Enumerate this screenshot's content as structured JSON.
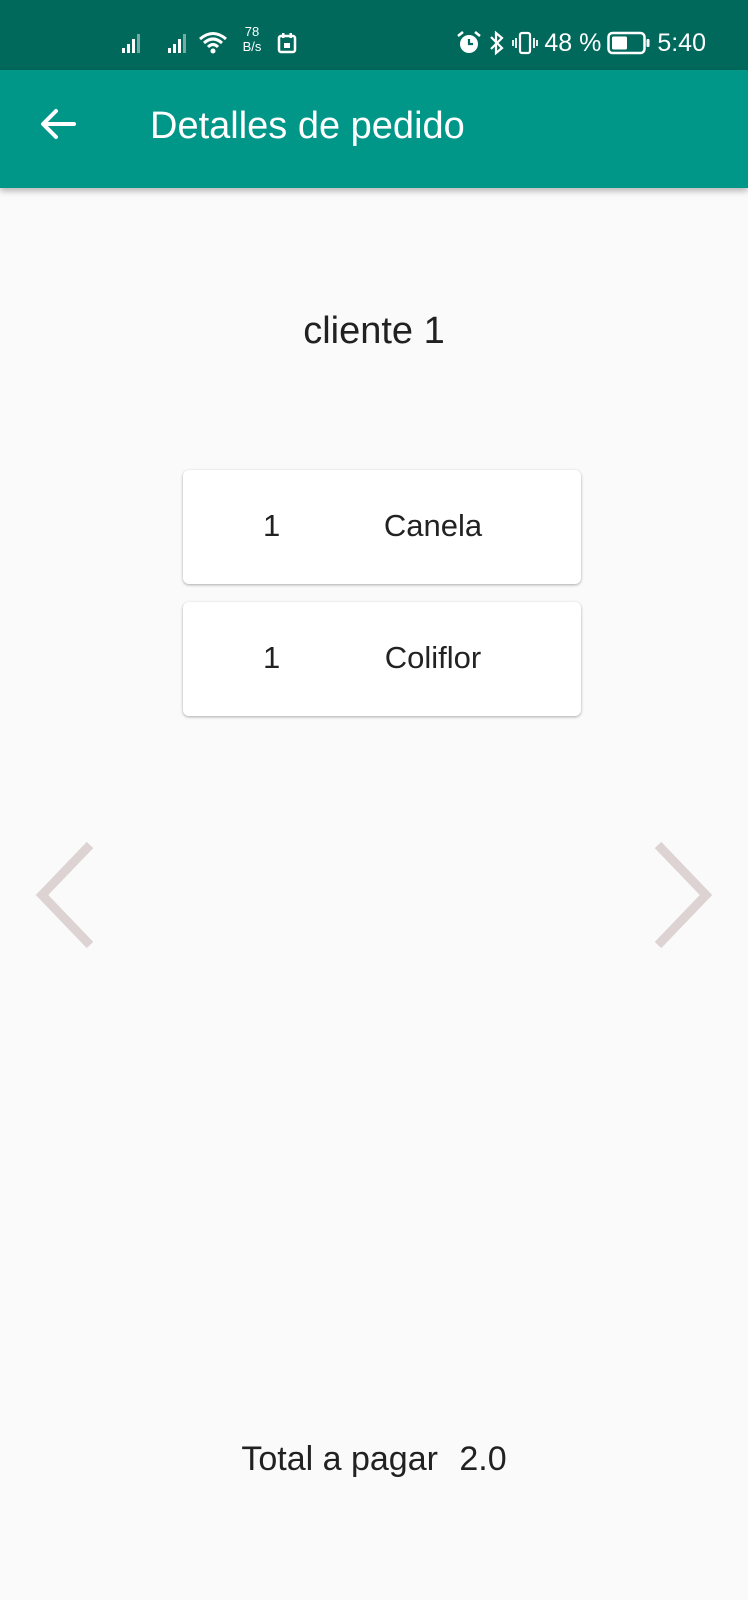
{
  "status_bar": {
    "network_speed_value": "78",
    "network_speed_unit": "B/s",
    "battery_percent": "48 %",
    "time": "5:40",
    "icons": [
      "signal-icon",
      "signal-icon",
      "wifi-icon",
      "calendar-icon",
      "alarm-icon",
      "bluetooth-icon",
      "vibrate-icon",
      "battery-icon"
    ]
  },
  "app_bar": {
    "title": "Detalles de pedido",
    "back_icon": "arrow-left-icon"
  },
  "order": {
    "client": "cliente 1",
    "items": [
      {
        "qty": "1",
        "name": "Canela"
      },
      {
        "qty": "1",
        "name": "Coliflor"
      }
    ],
    "total_label": "Total a pagar",
    "total_value": "2.0"
  },
  "navigation": {
    "prev_icon": "chevron-left-icon",
    "next_icon": "chevron-right-icon"
  },
  "colors": {
    "status_bar": "#00695c",
    "app_bar": "#009688",
    "background": "#fafafa",
    "nav_arrow": "#ddd3d3"
  }
}
